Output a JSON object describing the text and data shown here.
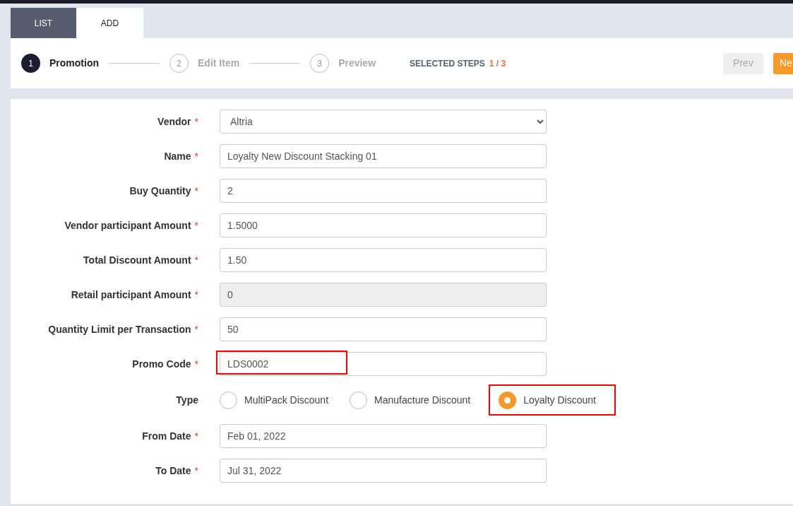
{
  "tabs": [
    {
      "label": "LIST",
      "selected": false
    },
    {
      "label": "ADD",
      "selected": true
    }
  ],
  "steps": {
    "items": [
      {
        "number": "1",
        "label": "Promotion",
        "selected": true
      },
      {
        "number": "2",
        "label": "Edit Item",
        "selected": false
      },
      {
        "number": "3",
        "label": "Preview",
        "selected": false
      }
    ],
    "selected_label": "SELECTED STEPS",
    "selected_count": "1 / 3",
    "buttons": [
      {
        "label": "Prev",
        "kind": "secondary"
      },
      {
        "label": "Ne",
        "kind": "primary"
      }
    ]
  },
  "form": [
    {
      "label": "Vendor",
      "required_mark": "*",
      "kind": "select",
      "value": "Altria"
    },
    {
      "label": "Name",
      "required_mark": "*",
      "kind": "text",
      "value": "Loyalty New Discount Stacking 01"
    },
    {
      "label": "Buy Quantity",
      "required_mark": "*",
      "kind": "text",
      "value": "2"
    },
    {
      "label": "Vendor participant Amount",
      "required_mark": "*",
      "kind": "text",
      "value": "1.5000"
    },
    {
      "label": "Total Discount Amount",
      "required_mark": "*",
      "kind": "text",
      "value": "1.50"
    },
    {
      "label": "Retail participant Amount",
      "required_mark": "*",
      "kind": "text",
      "value": "0",
      "disabled": true
    },
    {
      "label": "Quantity Limit per Transaction",
      "required_mark": "*",
      "kind": "text",
      "value": "50"
    },
    {
      "label": "Promo Code",
      "required_mark": "*",
      "kind": "text",
      "value": "LDS0002",
      "highlighted": true
    },
    {
      "label": "Type",
      "kind": "radio",
      "options": [
        {
          "label": "MultiPack Discount",
          "selected": false
        },
        {
          "label": "Manufacture Discount",
          "selected": false
        },
        {
          "label": "Loyalty Discount",
          "selected": true,
          "highlighted": true
        }
      ]
    },
    {
      "label": "From Date",
      "required_mark": "*",
      "kind": "text",
      "value": "Feb 01, 2022"
    },
    {
      "label": "To Date",
      "required_mark": "*",
      "kind": "text",
      "value": "Jul 31, 2022"
    }
  ]
}
